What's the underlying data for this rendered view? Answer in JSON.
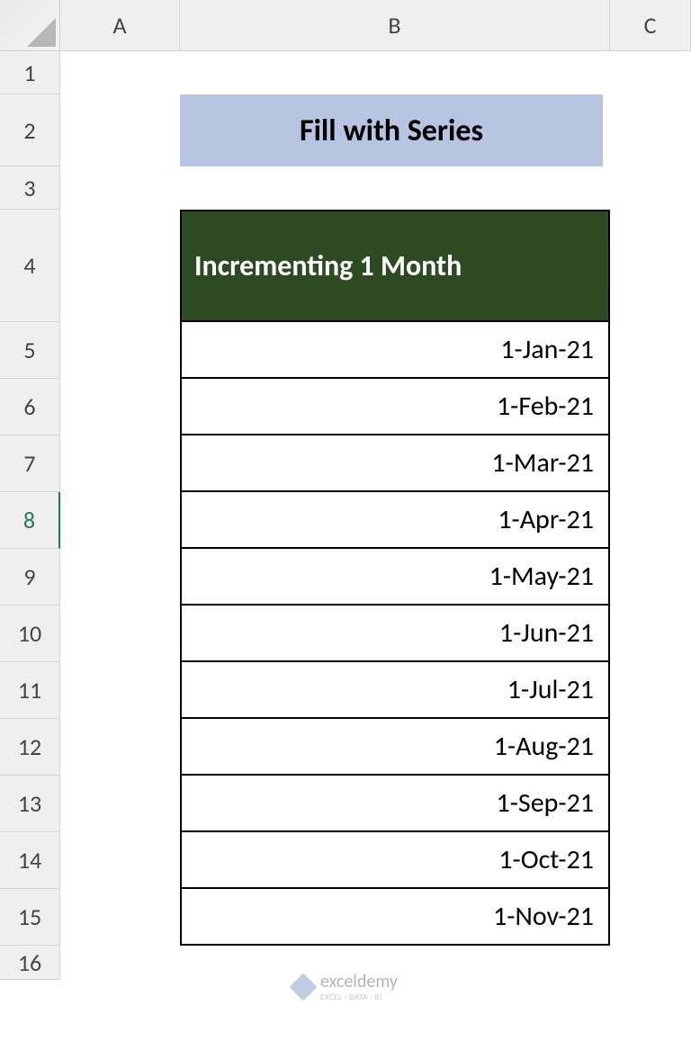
{
  "columns": [
    "A",
    "B",
    "C"
  ],
  "rows": [
    "1",
    "2",
    "3",
    "4",
    "5",
    "6",
    "7",
    "8",
    "9",
    "10",
    "11",
    "12",
    "13",
    "14",
    "15",
    "16"
  ],
  "active_row": "8",
  "title": "Fill with Series",
  "table_header": "Incrementing  1 Month",
  "dates": [
    "1-Jan-21",
    "1-Feb-21",
    "1-Mar-21",
    "1-Apr-21",
    "1-May-21",
    "1-Jun-21",
    "1-Jul-21",
    "1-Aug-21",
    "1-Sep-21",
    "1-Oct-21",
    "1-Nov-21"
  ],
  "watermark": {
    "name": "exceldemy",
    "tagline": "EXCEL · DATA · BI"
  }
}
